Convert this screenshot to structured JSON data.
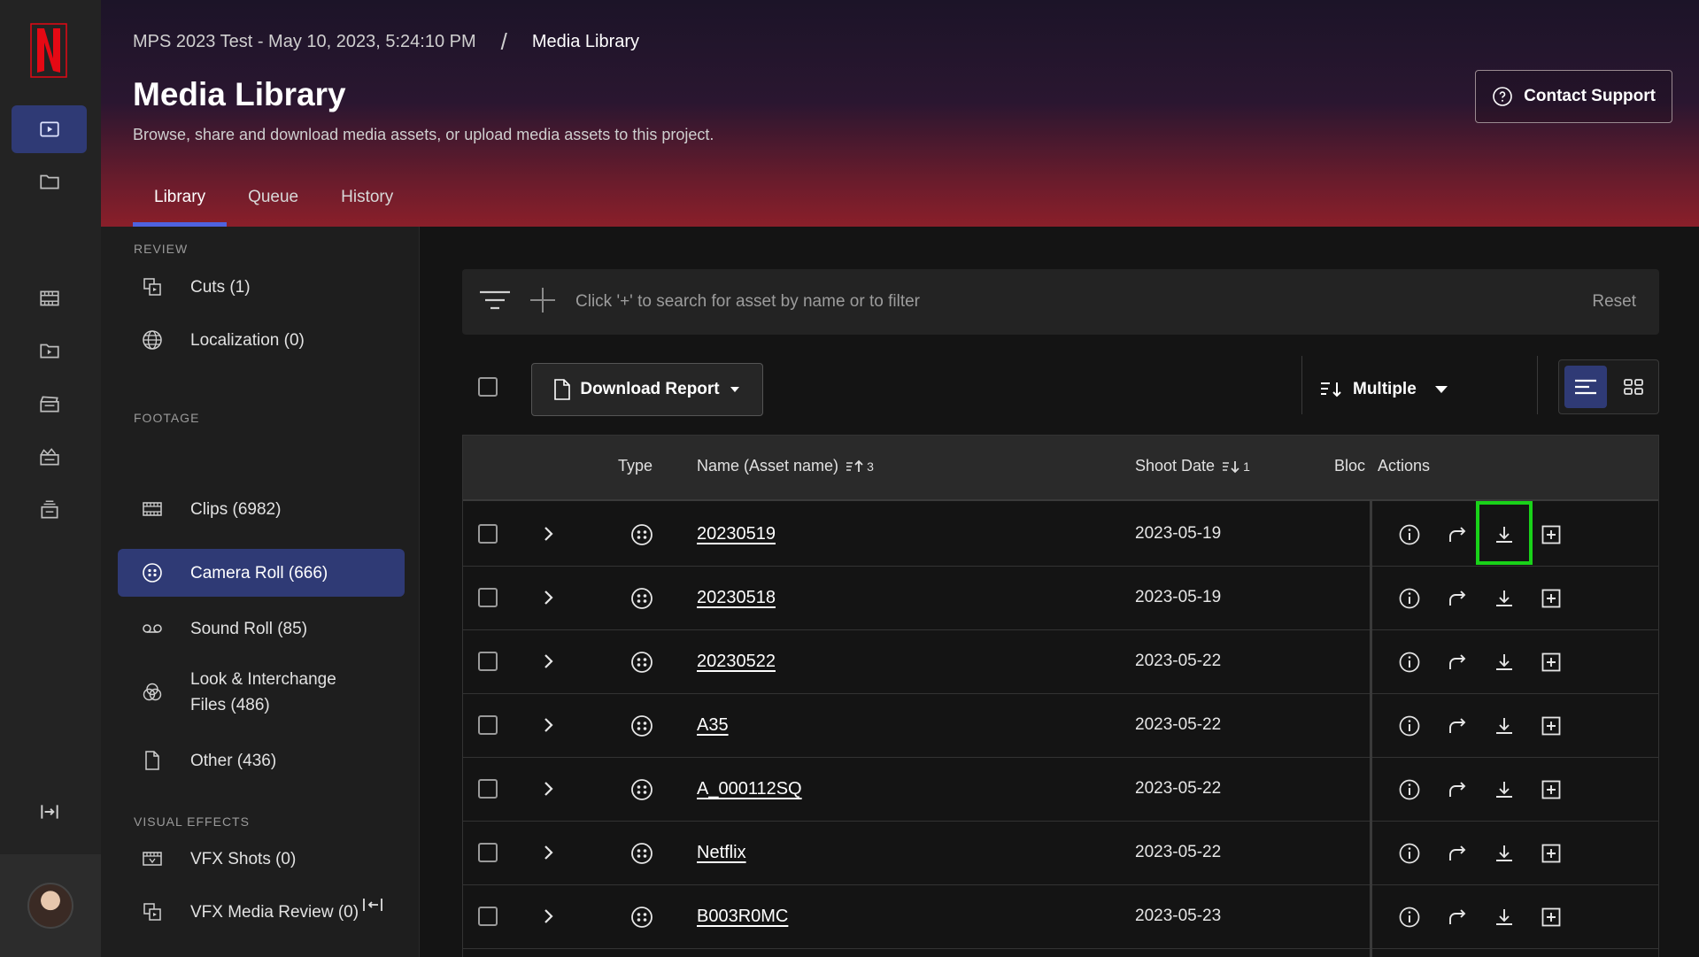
{
  "brand": {
    "logo_letter": "N",
    "accent": "#e50914",
    "nav_active": "#2f3a75",
    "tab_underline": "#4f62e0"
  },
  "rail": {
    "items": [
      {
        "icon": "play-box-icon",
        "active": true
      },
      {
        "icon": "folder-icon",
        "active": false
      },
      {
        "icon": "film-strip-icon",
        "active": false
      },
      {
        "icon": "folder-play-icon",
        "active": false
      },
      {
        "icon": "clapper-board-icon",
        "active": false
      },
      {
        "icon": "clapper-star-icon",
        "active": false
      },
      {
        "icon": "stack-box-icon",
        "active": false
      },
      {
        "icon": "collapse-rail-icon",
        "active": false
      }
    ]
  },
  "header": {
    "breadcrumb_project": "MPS 2023 Test - May 10, 2023, 5:24:10 PM",
    "breadcrumb_separator": "/",
    "breadcrumb_current": "Media Library",
    "title": "Media Library",
    "subtitle": "Browse, share and download media assets, or upload media assets to this project.",
    "support_label": "Contact Support",
    "tabs": [
      {
        "label": "Library",
        "active": true
      },
      {
        "label": "Queue",
        "active": false
      },
      {
        "label": "History",
        "active": false
      }
    ]
  },
  "sidebar": {
    "section_review": "REVIEW",
    "section_footage": "FOOTAGE",
    "section_vfx": "VISUAL EFFECTS",
    "items": [
      {
        "label": "Cuts (1)",
        "icon": "cuts-icon"
      },
      {
        "label": "Localization (0)",
        "icon": "globe-icon"
      },
      {
        "label": "Clips (6982)",
        "icon": "film-strip-icon"
      },
      {
        "label": "Camera Roll (666)",
        "icon": "camera-roll-icon",
        "active": true
      },
      {
        "label": "Sound Roll (85)",
        "icon": "sound-roll-icon"
      },
      {
        "label": "Look & Interchange Files (486)",
        "icon": "color-circles-icon"
      },
      {
        "label": "Other (436)",
        "icon": "file-icon"
      },
      {
        "label": "VFX Shots (0)",
        "icon": "vfx-film-icon"
      },
      {
        "label": "VFX Media Review (0)",
        "icon": "vfx-review-icon"
      }
    ]
  },
  "search": {
    "placeholder": "Click '+' to search for asset by name or to filter",
    "reset_label": "Reset"
  },
  "toolbar": {
    "download_report_label": "Download Report",
    "sort_label": "Multiple"
  },
  "table": {
    "columns": {
      "type": "Type",
      "name": "Name (Asset name)",
      "name_sort_order": "3",
      "shoot_date": "Shoot Date",
      "shoot_date_sort_order": "1",
      "bloc": "Bloc",
      "actions": "Actions"
    },
    "rows": [
      {
        "name": "20230519",
        "date": "2023-05-19"
      },
      {
        "name": "20230518",
        "date": "2023-05-19"
      },
      {
        "name": "20230522",
        "date": "2023-05-22"
      },
      {
        "name": "A35",
        "date": "2023-05-22"
      },
      {
        "name": "A_000112SQ",
        "date": "2023-05-22"
      },
      {
        "name": "Netflix",
        "date": "2023-05-22"
      },
      {
        "name": "B003R0MC",
        "date": "2023-05-23"
      }
    ],
    "highlighted_action": {
      "row": 0,
      "action": "download-icon",
      "color": "#19d219"
    }
  }
}
